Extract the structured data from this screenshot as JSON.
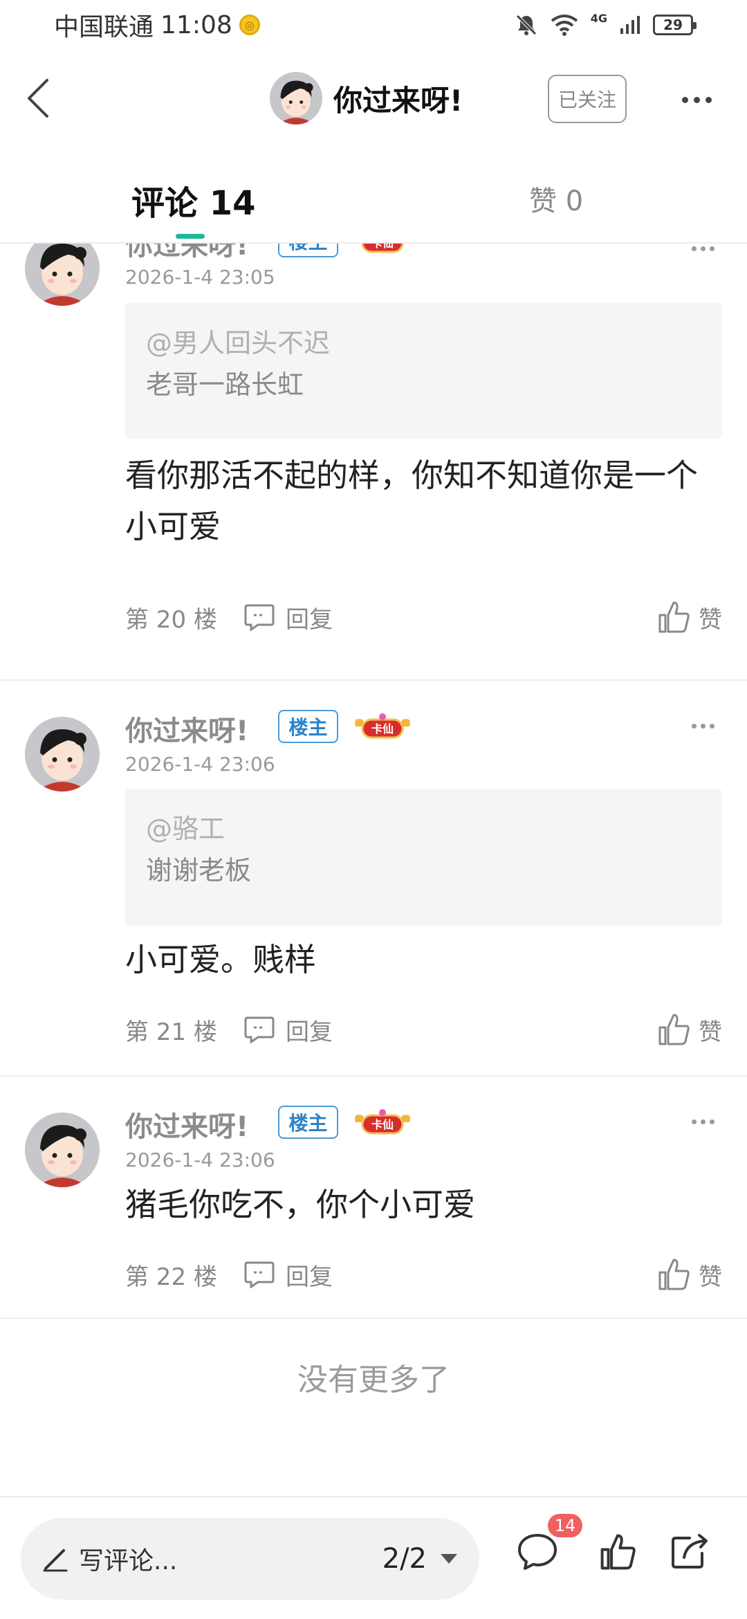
{
  "status_bar": {
    "carrier": "中国联通",
    "time": "11:08",
    "network": "4G",
    "battery": "29"
  },
  "nav": {
    "title": "你过来呀!",
    "follow_label": "已关注"
  },
  "tabs": {
    "comments_label": "评论 14",
    "likes_label": "赞 0"
  },
  "comments": [
    {
      "author": "你过来呀!",
      "owner_badge": "楼主",
      "rank_badge": "卡仙",
      "time": "2026-1-4 23:05",
      "quote_user": "@男人回头不迟",
      "quote_text": "老哥一路长虹",
      "body": "看你那活不起的样，你知不知道你是一个小可爱",
      "floor": "第 20 楼",
      "reply_label": "回复",
      "like_label": "赞"
    },
    {
      "author": "你过来呀!",
      "owner_badge": "楼主",
      "rank_badge": "卡仙",
      "time": "2026-1-4 23:06",
      "quote_user": "@骆工",
      "quote_text": "谢谢老板",
      "body": "小可爱。贱样",
      "floor": "第 21 楼",
      "reply_label": "回复",
      "like_label": "赞"
    },
    {
      "author": "你过来呀!",
      "owner_badge": "楼主",
      "rank_badge": "卡仙",
      "time": "2026-1-4 23:06",
      "body": "猪毛你吃不，你个小可爱",
      "floor": "第 22 楼",
      "reply_label": "回复",
      "like_label": "赞"
    }
  ],
  "no_more": "没有更多了",
  "bottom_bar": {
    "input_placeholder": "写评论...",
    "page_indicator": "2/2",
    "comment_count": "14"
  },
  "colors": {
    "accent": "#1cb89a",
    "owner_badge": "#2c83c8",
    "count_badge": "#f0605f"
  },
  "icons": [
    "back-icon",
    "more-icon",
    "reply-icon",
    "like-icon",
    "pencil-icon",
    "chevron-down-icon",
    "comment-icon",
    "thumb-up-icon",
    "share-icon"
  ]
}
